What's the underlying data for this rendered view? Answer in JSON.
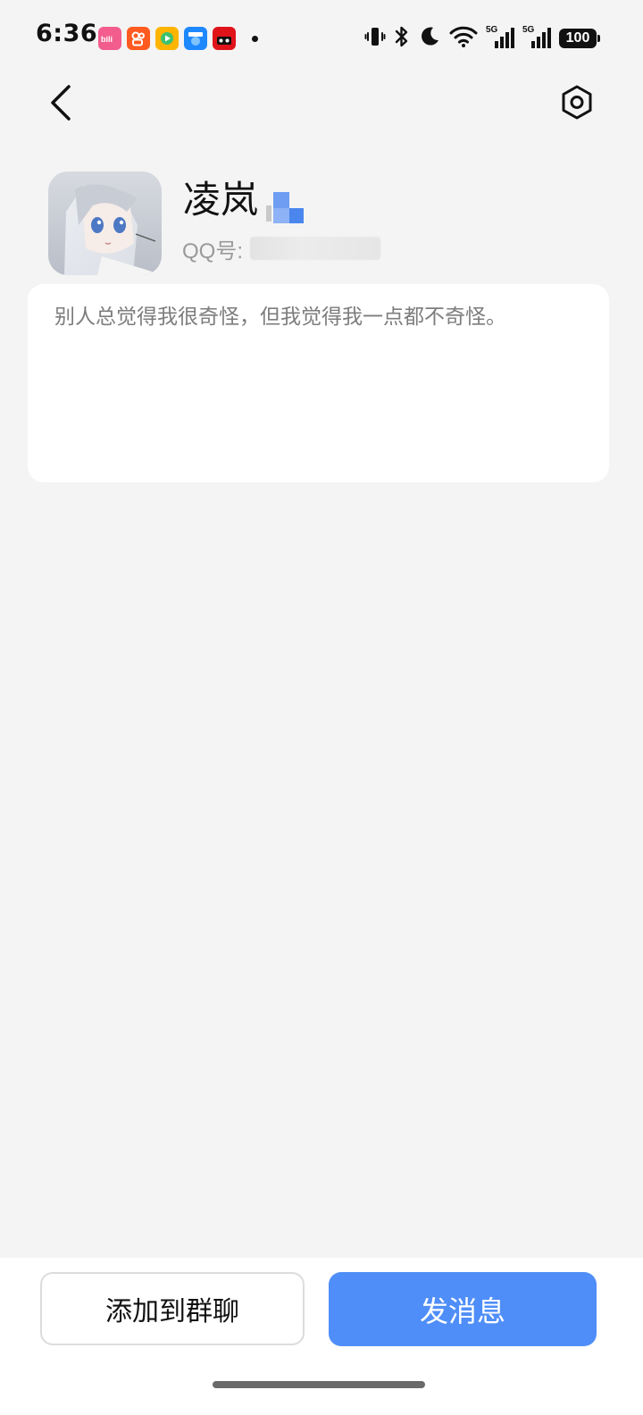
{
  "status_bar": {
    "time": "6:36",
    "battery": "100",
    "network_label": "5G",
    "notification_apps": [
      {
        "icon": "bilibili-icon",
        "color": "#f25d8e"
      },
      {
        "icon": "kuaishou-icon",
        "color": "#ff5a1f"
      },
      {
        "icon": "video-app-icon",
        "color": "#ffb400"
      },
      {
        "icon": "autohome-icon",
        "color": "#1e88ff"
      },
      {
        "icon": "tmall-icon",
        "color": "#e0131b"
      }
    ]
  },
  "nav": {
    "back_icon": "chevron-left-icon",
    "settings_icon": "gear-hexagon-icon"
  },
  "profile": {
    "nickname": "凌岚",
    "qq_label": "QQ号:",
    "signature": "别人总觉得我很奇怪，但我觉得我一点都不奇怪。"
  },
  "actions": {
    "add_to_group": "添加到群聊",
    "send_message": "发消息"
  },
  "colors": {
    "accent": "#4f8ef8",
    "background": "#f4f4f4",
    "card": "#ffffff"
  }
}
